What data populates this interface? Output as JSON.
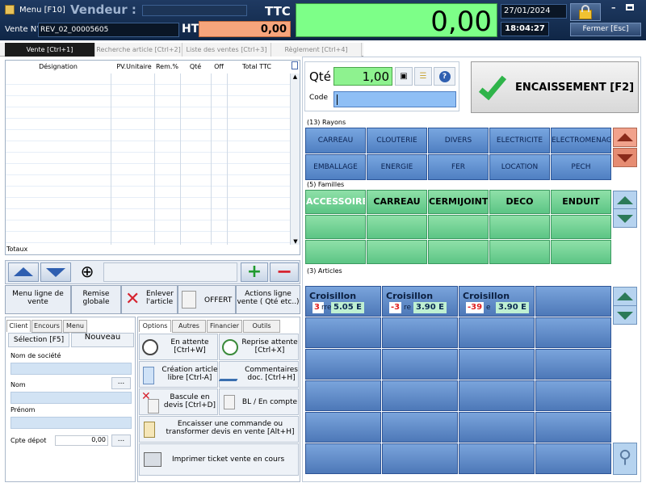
{
  "titlebar": {
    "menu": "Menu [F10]",
    "vendeur": "Vendeur :",
    "vente_label": "Vente N°",
    "vente_no": "REV_02_00005605",
    "ttc_label": "TTC",
    "ht_label": "HT",
    "ht_value": "0,00",
    "total": "0,00",
    "date": "27/01/2024",
    "time": "18:04:27",
    "close": "Fermer [Esc]"
  },
  "tabs": [
    "Vente [Ctrl+1]",
    "Recherche article [Ctrl+2]",
    "Liste des ventes [Ctrl+3]",
    "Règlement [Ctrl+4]"
  ],
  "grid": {
    "headers": [
      "Désignation",
      "PV.Unitaire",
      "Rem.%",
      "Qté",
      "Off",
      "Total TTC"
    ],
    "totaux": "Totaux"
  },
  "line_actions": {
    "menu_ligne": "Menu ligne de vente",
    "remise": "Remise globale",
    "enlever": "Enlever l'article",
    "offert": "OFFERT",
    "actions": "Actions ligne vente ( Qté etc..)"
  },
  "client_tabs": [
    "Client",
    "Encours",
    "Menu"
  ],
  "client": {
    "selection": "Sélection [F5]",
    "nouveau": "Nouveau",
    "societe_label": "Nom de société",
    "nom_label": "Nom",
    "prenom_label": "Prénom",
    "cpte_label": "Cpte dépot",
    "cpte_value": "0,00",
    "more": "..."
  },
  "options_tabs": [
    "Options",
    "Autres",
    "Financier",
    "Outils"
  ],
  "options": {
    "attente": "En attente [Ctrl+W]",
    "reprise": "Reprise attente [Ctrl+X]",
    "creation": "Création article libre [Ctrl-A]",
    "commentaires": "Commentaires doc. [Ctrl+H]",
    "bascule": "Bascule en devis [Ctrl+D]",
    "bl": "BL / En compte",
    "encaisser": "Encaisser une commande ou transformer devis en vente [Alt+H]",
    "imprimer": "Imprimer ticket vente en cours"
  },
  "qty": {
    "label": "Qté",
    "value": "1,00",
    "code_label": "Code"
  },
  "encaissement": "ENCAISSEMENT [F2]",
  "rayons": {
    "label": "(13) Rayons",
    "items": [
      "CARREAU",
      "CLOUTERIE",
      "DIVERS",
      "ELECTRICITE",
      "ELECTROMENAGE",
      "EMBALLAGE",
      "ENERGIE",
      "FER",
      "LOCATION",
      "PECH"
    ]
  },
  "familles": {
    "label": "(5) Familles",
    "items": [
      "ACCESSOIRES",
      "CARREAU",
      "CERMIJOINT",
      "DECO",
      "ENDUIT"
    ]
  },
  "articles": {
    "label": "(3) Articles",
    "items": [
      {
        "name": "Croisillon",
        "stock": "3",
        "price": "5.05 E",
        "frag": "rre"
      },
      {
        "name": "Croisillon",
        "stock": "-3",
        "price": "3.90 E",
        "frag": "re"
      },
      {
        "name": "Croisillon",
        "stock": "-39",
        "price": "3.90 E",
        "frag": "e"
      }
    ]
  },
  "colors": {
    "accent_green": "#5cc585",
    "blue_btn": "#4f7fc2",
    "ht_orange": "#f7a57c",
    "total_green": "#7dff88"
  }
}
